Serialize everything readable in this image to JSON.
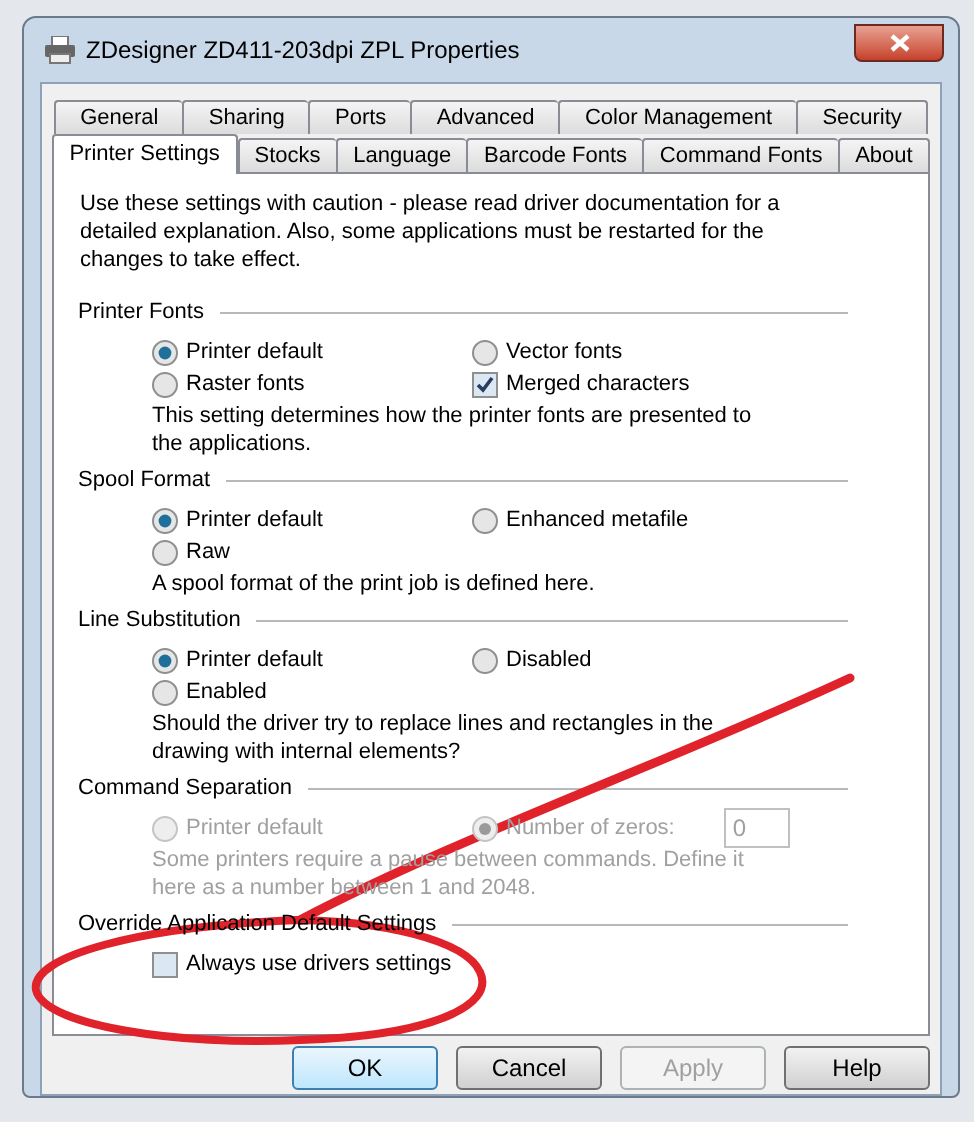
{
  "window": {
    "title": "ZDesigner ZD411-203dpi ZPL Properties"
  },
  "tab_rows": [
    [
      {
        "label": "General",
        "selected": false
      },
      {
        "label": "Sharing",
        "selected": false
      },
      {
        "label": "Ports",
        "selected": false
      },
      {
        "label": "Advanced",
        "selected": false
      },
      {
        "label": "Color Management",
        "selected": false
      },
      {
        "label": "Security",
        "selected": false
      }
    ],
    [
      {
        "label": "Printer Settings",
        "selected": true
      },
      {
        "label": "Stocks",
        "selected": false
      },
      {
        "label": "Language",
        "selected": false
      },
      {
        "label": "Barcode Fonts",
        "selected": false
      },
      {
        "label": "Command Fonts",
        "selected": false
      },
      {
        "label": "About",
        "selected": false
      }
    ]
  ],
  "intro": "Use these settings with caution - please read driver documentation for a detailed explanation. Also, some applications must be restarted for the changes to take effect.",
  "groups": [
    {
      "title": "Printer Fonts",
      "options": [
        {
          "kind": "radio",
          "label": "Printer default",
          "selected": true,
          "disabled": false
        },
        {
          "kind": "radio",
          "label": "Vector fonts",
          "selected": false,
          "disabled": false
        },
        {
          "kind": "radio",
          "label": "Raster fonts",
          "selected": false,
          "disabled": false
        },
        {
          "kind": "checkbox",
          "label": "Merged characters",
          "checked": true,
          "disabled": false
        }
      ],
      "description": "This setting determines how the printer fonts are presented to the applications."
    },
    {
      "title": "Spool Format",
      "options": [
        {
          "kind": "radio",
          "label": "Printer default",
          "selected": true,
          "disabled": false
        },
        {
          "kind": "radio",
          "label": "Enhanced metafile",
          "selected": false,
          "disabled": false
        },
        {
          "kind": "radio",
          "label": "Raw",
          "selected": false,
          "disabled": false
        }
      ],
      "description": "A spool format of the print job is defined here."
    },
    {
      "title": "Line Substitution",
      "options": [
        {
          "kind": "radio",
          "label": "Printer default",
          "selected": true,
          "disabled": false
        },
        {
          "kind": "radio",
          "label": "Disabled",
          "selected": false,
          "disabled": false
        },
        {
          "kind": "radio",
          "label": "Enabled",
          "selected": false,
          "disabled": false
        }
      ],
      "description": "Should the driver try to replace lines and rectangles in the drawing with internal elements?"
    },
    {
      "title": "Command Separation",
      "options": [
        {
          "kind": "radio",
          "label": "Printer default",
          "selected": false,
          "disabled": true
        },
        {
          "kind": "radio_field",
          "label": "Number of zeros:",
          "selected": true,
          "disabled": true,
          "value": "0"
        }
      ],
      "description": "Some printers require a pause between commands. Define it here as a number between 1 and 2048."
    },
    {
      "title": "Override Application Default Settings",
      "options": [
        {
          "kind": "checkbox",
          "label": "Always use drivers settings",
          "checked": false,
          "disabled": false
        }
      ]
    }
  ],
  "buttons": [
    {
      "label": "OK",
      "default": true,
      "disabled": false
    },
    {
      "label": "Cancel",
      "default": false,
      "disabled": false
    },
    {
      "label": "Apply",
      "default": false,
      "disabled": true
    },
    {
      "label": "Help",
      "default": false,
      "disabled": false
    }
  ]
}
